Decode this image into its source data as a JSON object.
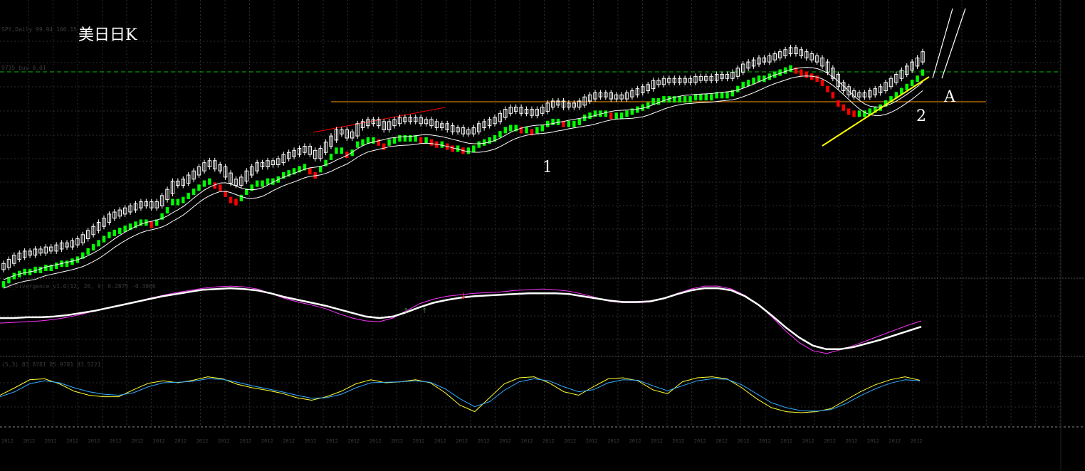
{
  "chart_data": [
    {
      "type": "candlestick",
      "title": "美日日K",
      "header": "SPY,Daily  99.94 100.15 9",
      "hline_label": "9715 buy 0.01",
      "annotations": [
        "1",
        "2",
        "A"
      ],
      "x_tick_labels": [
        "2012",
        "2012",
        "2012",
        "2012",
        "2012",
        "2012",
        "2012",
        "2012",
        "2012",
        "2012",
        "2012",
        "2012",
        "2012",
        "2012",
        "2012",
        "2012",
        "2012",
        "2012",
        "2012",
        "2012",
        "2012",
        "2012",
        "2012",
        "2012",
        "2012",
        "2012",
        "2012",
        "2012",
        "2012",
        "2012",
        "2012",
        "2012",
        "2012",
        "2012",
        "2012",
        "2012",
        "2012",
        "2012",
        "2012",
        "2012",
        "2012",
        "2012",
        "2012"
      ],
      "colors": {
        "up_body": "#00ff00",
        "down_body": "#ff0000",
        "candle_outline": "#ffffff",
        "ma": "#ffffff",
        "hline_green": "#00c000",
        "hline_orange": "#ff9900",
        "trend_yellow": "#ffff00",
        "trend_red": "#ff0000",
        "grid": "#3a3a3a"
      },
      "close": [
        0.31,
        0.33,
        0.35,
        0.36,
        0.37,
        0.37,
        0.38,
        0.38,
        0.39,
        0.39,
        0.4,
        0.41,
        0.41,
        0.42,
        0.43,
        0.45,
        0.47,
        0.49,
        0.51,
        0.53,
        0.55,
        0.56,
        0.57,
        0.58,
        0.59,
        0.6,
        0.61,
        0.61,
        0.6,
        0.61,
        0.64,
        0.67,
        0.71,
        0.71,
        0.72,
        0.74,
        0.76,
        0.78,
        0.8,
        0.81,
        0.79,
        0.78,
        0.75,
        0.72,
        0.71,
        0.73,
        0.76,
        0.78,
        0.8,
        0.8,
        0.81,
        0.81,
        0.82,
        0.84,
        0.85,
        0.86,
        0.87,
        0.88,
        0.86,
        0.84,
        0.87,
        0.9,
        0.93,
        0.96,
        0.96,
        0.94,
        0.95,
        0.99,
        1.0,
        1.01,
        1.01,
        1.0,
        0.98,
        1.0,
        1.01,
        1.02,
        1.02,
        1.02,
        1.02,
        1.01,
        1.01,
        1.0,
        0.99,
        0.99,
        0.98,
        0.97,
        0.97,
        0.96,
        0.96,
        0.97,
        0.99,
        1.0,
        1.01,
        1.02,
        1.04,
        1.06,
        1.07,
        1.07,
        1.06,
        1.06,
        1.05,
        1.06,
        1.07,
        1.09,
        1.1,
        1.1,
        1.09,
        1.09,
        1.09,
        1.1,
        1.12,
        1.13,
        1.14,
        1.14,
        1.14,
        1.13,
        1.13,
        1.13,
        1.14,
        1.15,
        1.16,
        1.17,
        1.18,
        1.2,
        1.2,
        1.21,
        1.21,
        1.21,
        1.21,
        1.21,
        1.21,
        1.22,
        1.22,
        1.22,
        1.22,
        1.23,
        1.23,
        1.23,
        1.24,
        1.26,
        1.28,
        1.29,
        1.3,
        1.31,
        1.31,
        1.32,
        1.33,
        1.34,
        1.35,
        1.36,
        1.35,
        1.34,
        1.33,
        1.32,
        1.31,
        1.29,
        1.26,
        1.23,
        1.19,
        1.17,
        1.15,
        1.14,
        1.14,
        1.14,
        1.15,
        1.16,
        1.17,
        1.19,
        1.21,
        1.23,
        1.25,
        1.27,
        1.29,
        1.31,
        1.34
      ]
    },
    {
      "type": "line",
      "header": "ACD_Divergence_v1.0(12, 26, 9) 0.2875 -0.3066",
      "series": [
        {
          "values": [
            0.45,
            0.46,
            0.47,
            0.48,
            0.5,
            0.53,
            0.57,
            0.62,
            0.66,
            0.7,
            0.74,
            0.79,
            0.83,
            0.87,
            0.9,
            0.93,
            0.95,
            0.96,
            0.95,
            0.92,
            0.86,
            0.79,
            0.74,
            0.7,
            0.65,
            0.58,
            0.52,
            0.48,
            0.47,
            0.52,
            0.62,
            0.72,
            0.78,
            0.82,
            0.84,
            0.86,
            0.87,
            0.88,
            0.9,
            0.91,
            0.92,
            0.91,
            0.89,
            0.85,
            0.8,
            0.75,
            0.73,
            0.73,
            0.74,
            0.79,
            0.86,
            0.92,
            0.96,
            0.96,
            0.92,
            0.83,
            0.7,
            0.53,
            0.34,
            0.18,
            0.07,
            0.03,
            0.08,
            0.14,
            0.21,
            0.28,
            0.35,
            0.42,
            0.48
          ],
          "color": "#ff33ff"
        },
        {
          "values": [
            0.52,
            0.52,
            0.53,
            0.53,
            0.54,
            0.56,
            0.59,
            0.62,
            0.66,
            0.7,
            0.74,
            0.78,
            0.82,
            0.85,
            0.88,
            0.91,
            0.92,
            0.93,
            0.92,
            0.9,
            0.86,
            0.81,
            0.77,
            0.73,
            0.69,
            0.64,
            0.59,
            0.54,
            0.52,
            0.54,
            0.6,
            0.67,
            0.73,
            0.77,
            0.8,
            0.82,
            0.83,
            0.84,
            0.85,
            0.86,
            0.86,
            0.86,
            0.85,
            0.82,
            0.79,
            0.76,
            0.74,
            0.74,
            0.75,
            0.79,
            0.85,
            0.9,
            0.93,
            0.93,
            0.9,
            0.82,
            0.7,
            0.55,
            0.39,
            0.25,
            0.14,
            0.09,
            0.09,
            0.12,
            0.17,
            0.22,
            0.28,
            0.34,
            0.4
          ],
          "color": "#ffffff"
        }
      ],
      "markers": [
        "down-arrow",
        "up-arrow",
        "up-arrow"
      ]
    },
    {
      "type": "line",
      "header": "(5,3) 83.8781 85.9781 83.5221",
      "series": [
        {
          "values": [
            0.55,
            0.7,
            0.86,
            0.88,
            0.78,
            0.63,
            0.55,
            0.52,
            0.52,
            0.66,
            0.79,
            0.84,
            0.8,
            0.85,
            0.92,
            0.88,
            0.77,
            0.7,
            0.65,
            0.59,
            0.5,
            0.45,
            0.52,
            0.63,
            0.78,
            0.86,
            0.8,
            0.82,
            0.86,
            0.8,
            0.6,
            0.35,
            0.22,
            0.5,
            0.78,
            0.9,
            0.92,
            0.8,
            0.62,
            0.55,
            0.72,
            0.88,
            0.9,
            0.84,
            0.66,
            0.58,
            0.82,
            0.9,
            0.92,
            0.88,
            0.7,
            0.48,
            0.3,
            0.22,
            0.2,
            0.22,
            0.28,
            0.45,
            0.62,
            0.76,
            0.86,
            0.92,
            0.85
          ],
          "color": "#ffff33"
        },
        {
          "values": [
            0.52,
            0.62,
            0.78,
            0.84,
            0.8,
            0.7,
            0.62,
            0.57,
            0.55,
            0.6,
            0.72,
            0.8,
            0.81,
            0.83,
            0.88,
            0.87,
            0.81,
            0.74,
            0.68,
            0.62,
            0.55,
            0.49,
            0.5,
            0.57,
            0.7,
            0.8,
            0.81,
            0.82,
            0.84,
            0.81,
            0.68,
            0.48,
            0.32,
            0.42,
            0.65,
            0.82,
            0.88,
            0.84,
            0.72,
            0.62,
            0.66,
            0.8,
            0.86,
            0.85,
            0.74,
            0.64,
            0.74,
            0.84,
            0.88,
            0.87,
            0.76,
            0.58,
            0.4,
            0.3,
            0.24,
            0.23,
            0.26,
            0.38,
            0.54,
            0.68,
            0.79,
            0.86,
            0.84
          ],
          "color": "#33aaff"
        }
      ]
    }
  ]
}
